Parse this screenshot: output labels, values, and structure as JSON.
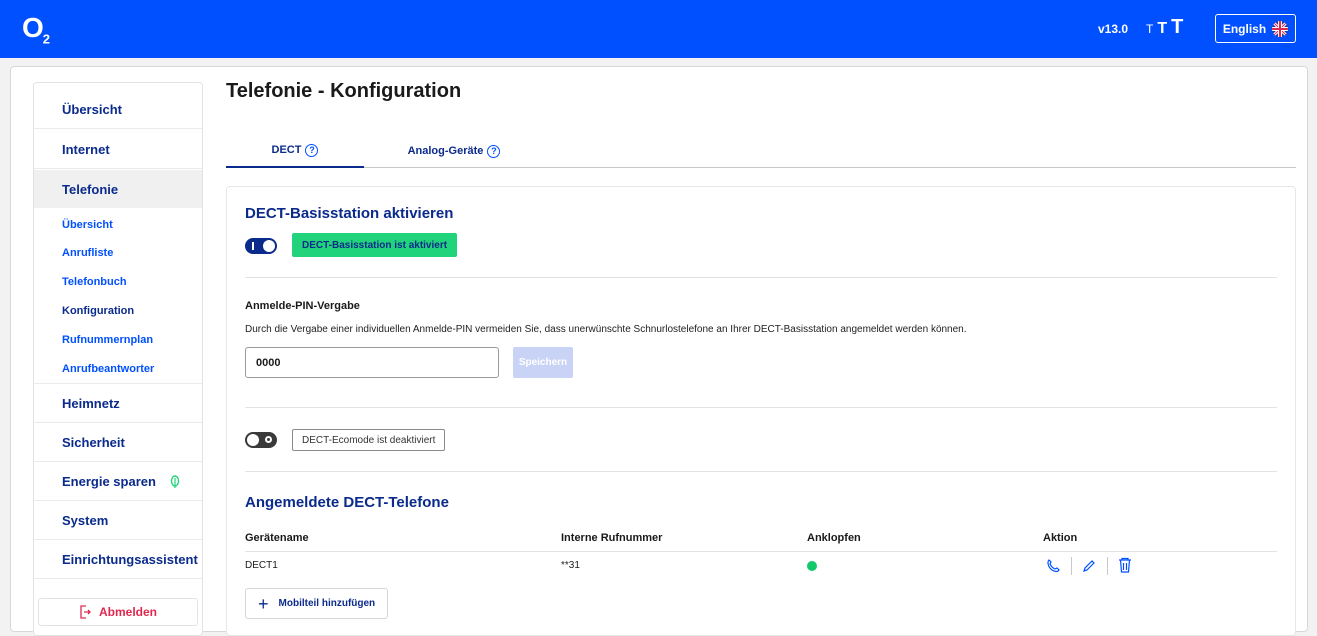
{
  "header": {
    "logo": "O",
    "logo_sub": "2",
    "version": "v13.0",
    "font_size_small": "T",
    "font_size_medium": "T",
    "font_size_large": "T",
    "language": "English"
  },
  "sidebar": {
    "items": [
      {
        "label": "Übersicht"
      },
      {
        "label": "Internet"
      },
      {
        "label": "Telefonie"
      },
      {
        "label": "Heimnetz"
      },
      {
        "label": "Sicherheit"
      },
      {
        "label": "Energie sparen"
      },
      {
        "label": "System"
      },
      {
        "label": "Einrichtungsassistent"
      }
    ],
    "sub_items": [
      {
        "label": "Übersicht"
      },
      {
        "label": "Anrufliste"
      },
      {
        "label": "Telefonbuch"
      },
      {
        "label": "Konfiguration"
      },
      {
        "label": "Rufnummernplan"
      },
      {
        "label": "Anrufbeantworter"
      }
    ],
    "logout": "Abmelden"
  },
  "page": {
    "title": "Telefonie - Konfiguration",
    "tabs": [
      {
        "label": "DECT"
      },
      {
        "label": "Analog-Geräte"
      }
    ]
  },
  "dect": {
    "section_title": "DECT-Basisstation aktivieren",
    "base_status": "DECT-Basisstation ist aktiviert",
    "pin_label": "Anmelde-PIN-Vergabe",
    "pin_description": "Durch die Vergabe einer individuellen Anmelde-PIN vermeiden Sie, dass unerwünschte Schnurlostelefone an Ihrer DECT-Basisstation angemeldet werden können.",
    "pin_value": "0000",
    "save_label": "Speichern",
    "ecomode_status": "DECT-Ecomode ist deaktiviert"
  },
  "phones": {
    "title": "Angemeldete DECT-Telefone",
    "columns": [
      "Gerätename",
      "Interne Rufnummer",
      "Anklopfen",
      "Aktion"
    ],
    "rows": [
      {
        "name": "DECT1",
        "number": "**31",
        "call_waiting": true
      }
    ],
    "add_label": "Mobilteil hinzufügen"
  },
  "colors": {
    "brand": "#0050ff",
    "nav_text": "#0a2a8c",
    "active_green": "#21d37a",
    "logout_red": "#e0284f"
  },
  "icons": [
    "flag-uk-icon",
    "help-icon",
    "leaf-icon",
    "logout-icon",
    "phone-icon",
    "edit-icon",
    "trash-icon",
    "plus-icon"
  ]
}
